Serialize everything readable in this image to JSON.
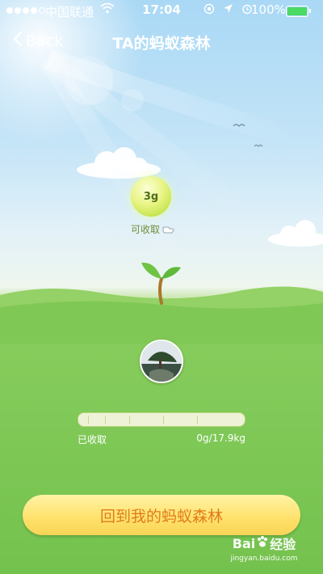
{
  "status_bar": {
    "carrier": "中国联通",
    "time": "17:04",
    "battery_percent": "100%"
  },
  "nav": {
    "back_label": "Back",
    "title": "TA的蚂蚁森林"
  },
  "energy_ball": {
    "amount": "3g",
    "collect_label": "可收取"
  },
  "progress": {
    "left_label": "已收取",
    "right_label": "0g/17.9kg",
    "fraction": 0
  },
  "return_button": {
    "label": "回到我的蚂蚁森林"
  },
  "watermark": {
    "brand_left": "Bai",
    "brand_right": "经验",
    "url": "jingyan.baidu.com"
  },
  "colors": {
    "sky_top": "#a9d8f5",
    "grass": "#78c453",
    "button_text": "#e07c1c",
    "button_bg": "#ffe16a"
  }
}
